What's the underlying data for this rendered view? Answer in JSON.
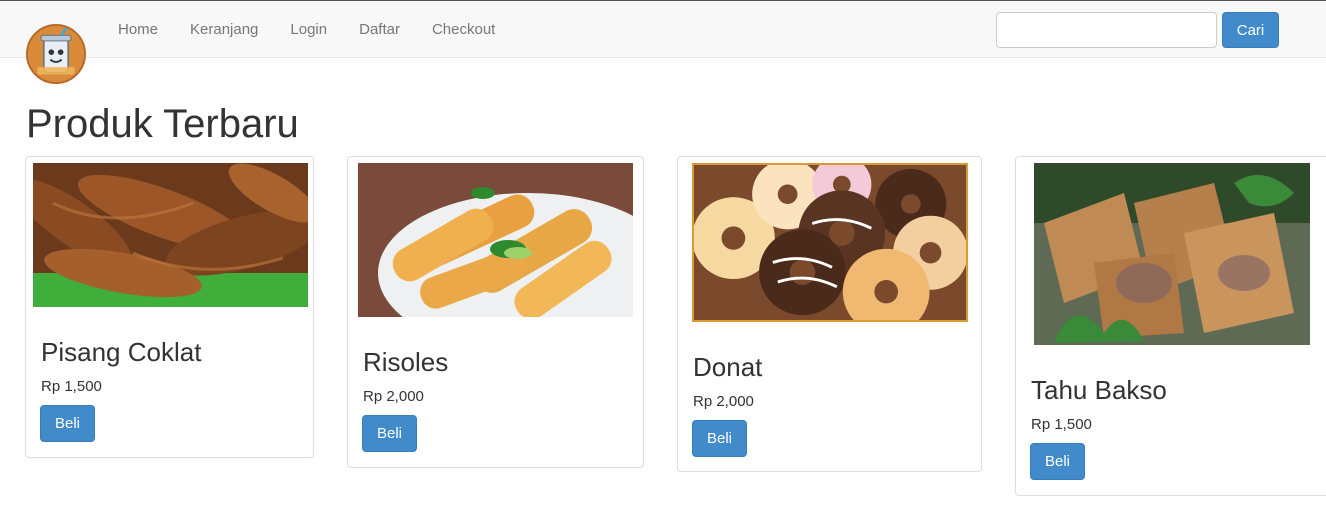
{
  "nav": {
    "links": [
      "Home",
      "Keranjang",
      "Login",
      "Daftar",
      "Checkout"
    ],
    "search_placeholder": "",
    "search_button": "Cari"
  },
  "page": {
    "title": "Produk Terbaru"
  },
  "products": [
    {
      "name": "Pisang Coklat",
      "price": "Rp 1,500",
      "buy_label": "Beli"
    },
    {
      "name": "Risoles",
      "price": "Rp 2,000",
      "buy_label": "Beli"
    },
    {
      "name": "Donat",
      "price": "Rp 2,000",
      "buy_label": "Beli"
    },
    {
      "name": "Tahu Bakso",
      "price": "Rp 1,500",
      "buy_label": "Beli"
    }
  ],
  "colors": {
    "primary": "#428bca",
    "navbar": "#f8f8f8",
    "text": "#333333"
  }
}
